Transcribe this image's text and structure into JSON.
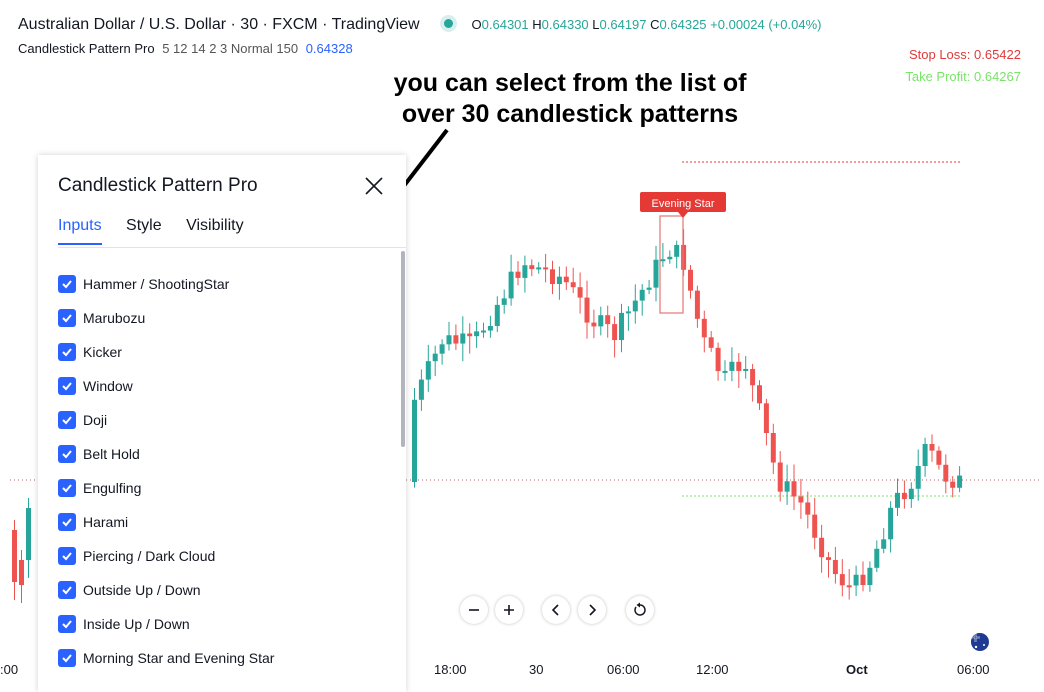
{
  "header": {
    "symbol_title": "Australian Dollar / U.S. Dollar · 30 · FXCM · TradingView",
    "o_label": "O",
    "o_value": "0.64301",
    "h_label": "H",
    "h_value": "0.64330",
    "l_label": "L",
    "l_value": "0.64197",
    "c_label": "C",
    "c_value": "0.64325",
    "change": "+0.00024 (+0.04%)"
  },
  "indicator": {
    "name": "Candlestick Pattern Pro",
    "params": "5 12 14 2 3 Normal 150",
    "value": "0.64328"
  },
  "levels": {
    "stop_loss": "Stop Loss: 0.65422",
    "take_profit": "Take Profit: 0.64267"
  },
  "annotation": {
    "line1": "you can select from the list of",
    "line2": "over 30 candlestick patterns"
  },
  "pattern_label": "Evening Star",
  "panel": {
    "title": "Candlestick Pattern Pro",
    "tabs": [
      {
        "label": "Inputs"
      },
      {
        "label": "Style"
      },
      {
        "label": "Visibility"
      }
    ],
    "patterns": [
      {
        "label": "Hammer / ShootingStar"
      },
      {
        "label": "Marubozu"
      },
      {
        "label": "Kicker"
      },
      {
        "label": "Window"
      },
      {
        "label": "Doji"
      },
      {
        "label": "Belt Hold"
      },
      {
        "label": "Engulfing"
      },
      {
        "label": "Harami"
      },
      {
        "label": "Piercing / Dark Cloud"
      },
      {
        "label": "Outside Up / Down"
      },
      {
        "label": "Inside Up / Down"
      },
      {
        "label": "Morning Star and Evening Star"
      }
    ]
  },
  "time_axis": [
    "18:00",
    "30",
    "06:00",
    "12:00",
    "Oct",
    "06:00"
  ],
  "time_axis_left_partial": ":00",
  "controls": [
    "minus-icon",
    "plus-icon",
    "chevron-left-icon",
    "chevron-right-icon",
    "reset-icon"
  ],
  "colors": {
    "bull": "#26a69a",
    "bear": "#ef5350",
    "accent": "#2962ff",
    "stop_loss": "#e03a3a",
    "take_profit": "#7be36b"
  }
}
